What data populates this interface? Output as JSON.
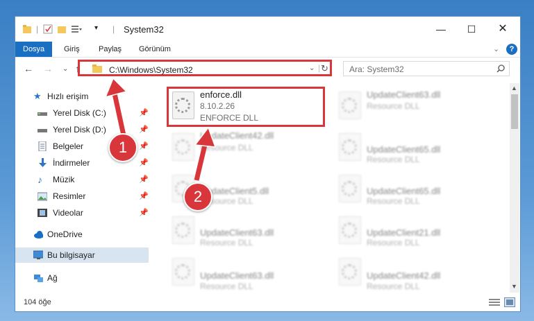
{
  "window": {
    "title": "System32",
    "controls": [
      "minimize-icon",
      "maximize-icon",
      "close-icon"
    ]
  },
  "ribbon": {
    "tabs": [
      "Dosya",
      "Giriş",
      "Paylaş",
      "Görünüm"
    ],
    "help": "?"
  },
  "nav": {
    "address": "C:\\Windows\\System32",
    "search_placeholder": "Ara: System32"
  },
  "sidebar": {
    "quick_access": "Hızlı erişim",
    "items": [
      "Yerel Disk (C:)",
      "Yerel Disk (D:)",
      "Belgeler",
      "İndirmeler",
      "Müzik",
      "Resimler",
      "Videolar"
    ],
    "onedrive": "OneDrive",
    "this_pc": "Bu bilgisayar",
    "network": "Ağ"
  },
  "files": {
    "highlighted": {
      "name": "enforce.dll",
      "version": "8.10.2.26",
      "desc": "ENFORCE DLL"
    },
    "left": [
      {
        "name": "UpdateClient42.dll",
        "desc": "Resource DLL"
      },
      {
        "name": "UpdateClient5.dll",
        "desc": "Resource DLL"
      },
      {
        "name": "UpdateClient63.dll",
        "desc": "Resource DLL"
      },
      {
        "name": "UpdateClient63.dll",
        "desc": "Resource DLL"
      }
    ],
    "right": [
      {
        "name": "UpdateClient63.dll",
        "desc": "Resource DLL"
      },
      {
        "name": "UpdateClient65.dll",
        "desc": "Resource DLL"
      },
      {
        "name": "UpdateClient65.dll",
        "desc": "Resource DLL"
      },
      {
        "name": "UpdateClient21.dll",
        "desc": "Resource DLL"
      },
      {
        "name": "UpdateClient42.dll",
        "desc": "Resource DLL"
      }
    ]
  },
  "status": {
    "count": "104 öğe"
  },
  "callouts": [
    "1",
    "2"
  ],
  "colors": {
    "accent": "#1a6fc2",
    "highlight": "#d8363a"
  }
}
